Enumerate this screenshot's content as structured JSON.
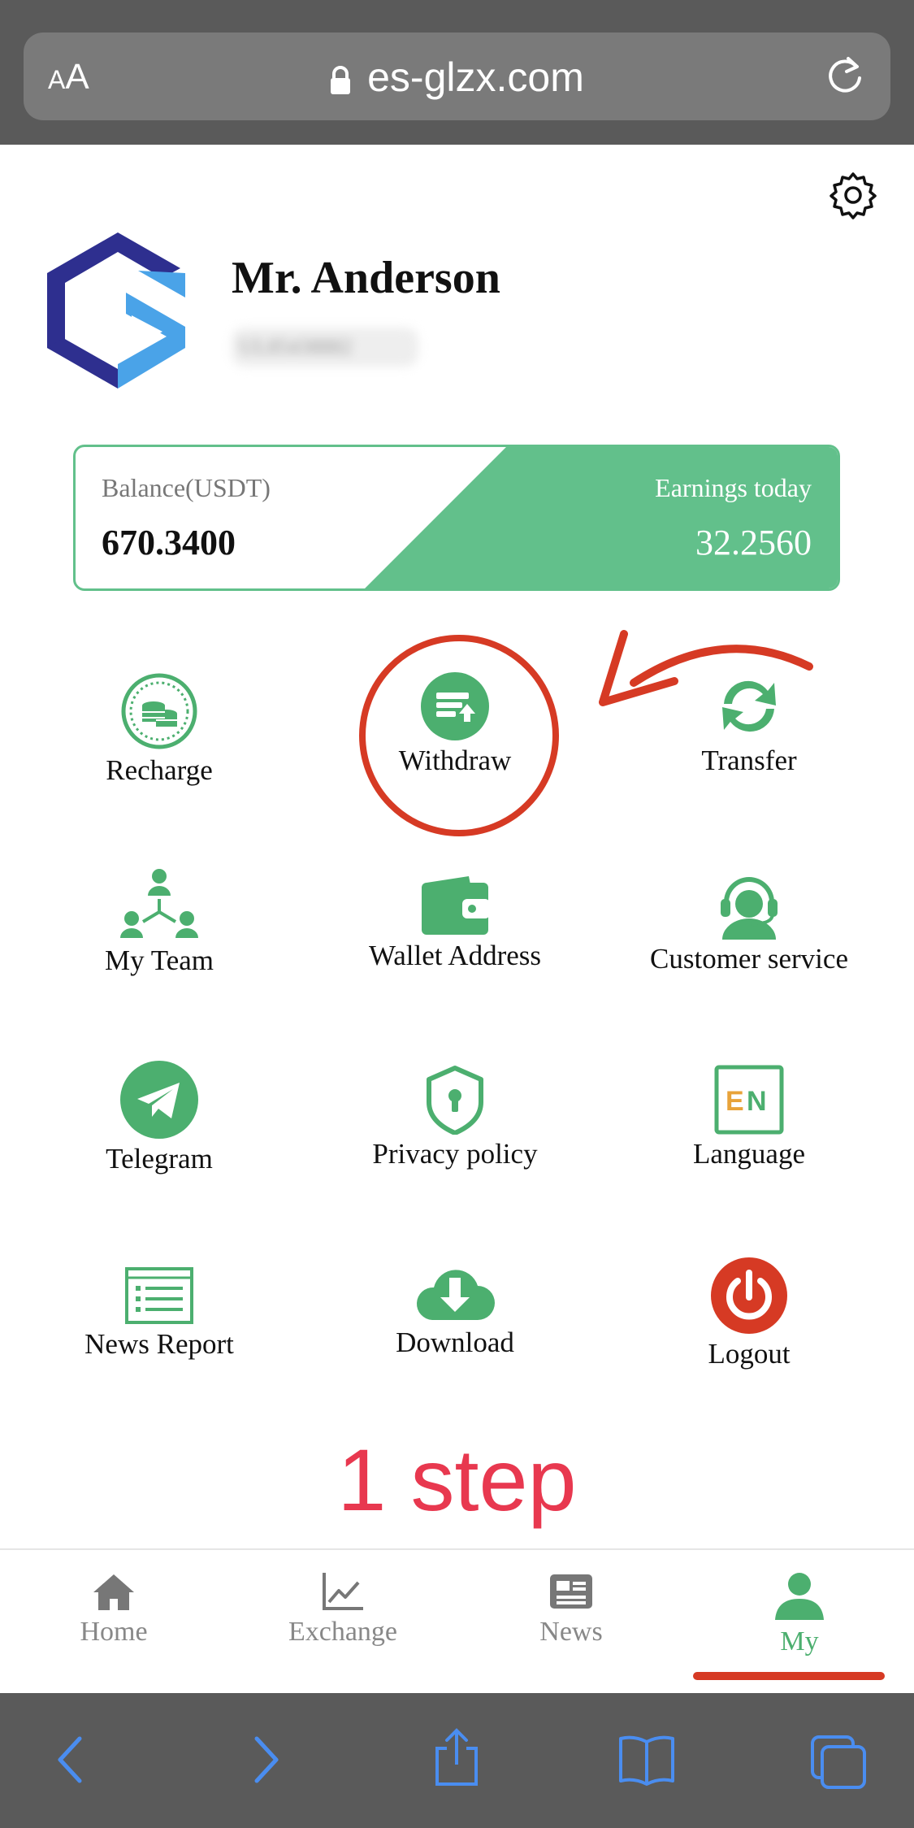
{
  "browser": {
    "text_size_label_small": "A",
    "text_size_label_large": "A",
    "url": "es-glzx.com"
  },
  "profile": {
    "name": "Mr. Anderson",
    "id_blurred": "UL85438882"
  },
  "balance": {
    "label": "Balance(USDT)",
    "value": "670.3400",
    "earnings_label": "Earnings today",
    "earnings_value": "32.2560"
  },
  "menu": [
    {
      "label": "Recharge",
      "icon": "coins-icon"
    },
    {
      "label": "Withdraw",
      "icon": "withdraw-icon"
    },
    {
      "label": "Transfer",
      "icon": "transfer-icon"
    },
    {
      "label": "My Team",
      "icon": "team-icon"
    },
    {
      "label": "Wallet Address",
      "icon": "wallet-icon"
    },
    {
      "label": "Customer service",
      "icon": "headset-icon"
    },
    {
      "label": "Telegram",
      "icon": "telegram-icon"
    },
    {
      "label": "Privacy policy",
      "icon": "shield-icon"
    },
    {
      "label": "Language",
      "icon": "language-en-icon"
    },
    {
      "label": "News Report",
      "icon": "news-list-icon"
    },
    {
      "label": "Download",
      "icon": "cloud-download-icon"
    },
    {
      "label": "Logout",
      "icon": "power-icon"
    }
  ],
  "annotation": {
    "step_text": "1 step"
  },
  "tabs": [
    {
      "label": "Home",
      "icon": "home-icon"
    },
    {
      "label": "Exchange",
      "icon": "chart-icon"
    },
    {
      "label": "News",
      "icon": "newspaper-icon"
    },
    {
      "label": "My",
      "icon": "user-icon",
      "active": true
    }
  ],
  "colors": {
    "accent_green": "#62c08b",
    "annotation_red": "#d63a24",
    "step_red": "#e8384f",
    "logout_red": "#d63a24",
    "logo_navy": "#2e2f8f",
    "logo_blue": "#4aa3e8"
  }
}
